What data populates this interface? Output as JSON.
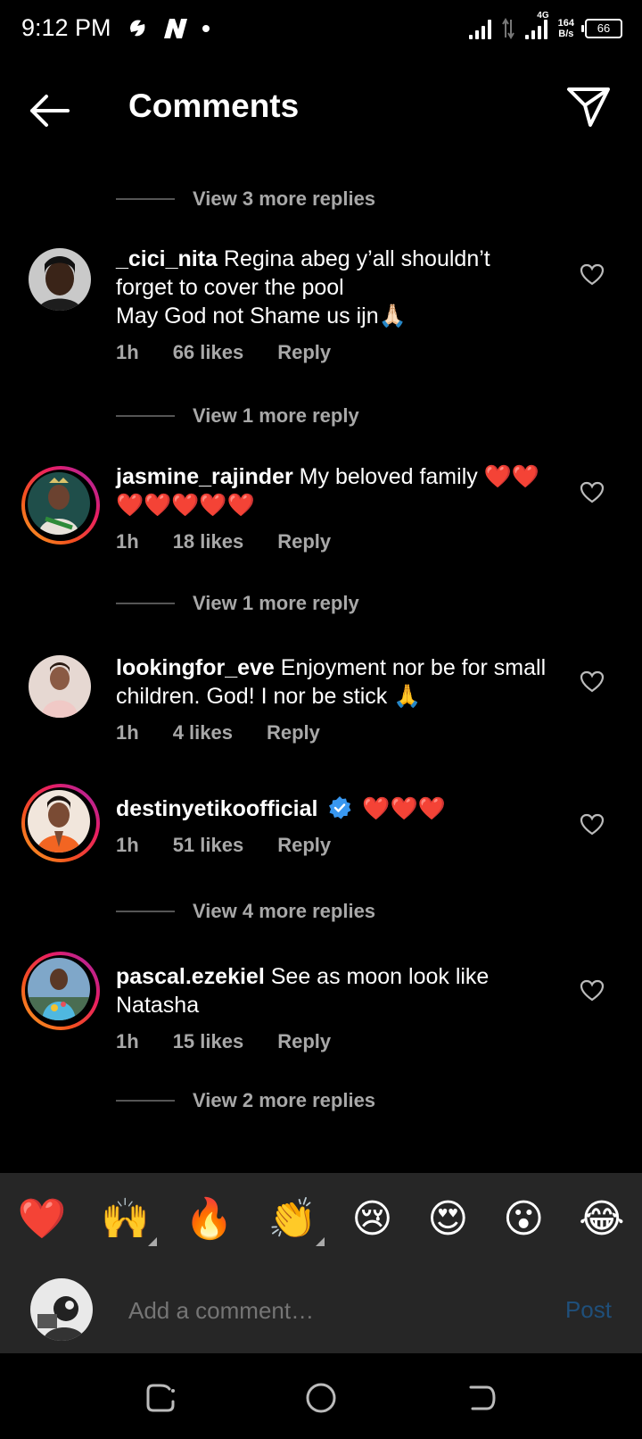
{
  "status_bar": {
    "time": "9:12 PM",
    "network_speed_value": "164",
    "network_speed_unit": "B/s",
    "network_type": "4G",
    "battery": "66"
  },
  "header": {
    "title": "Comments"
  },
  "view_more": [
    "View 3 more replies",
    "View 1 more reply",
    "View 1 more reply",
    "View 4 more replies",
    "View 2 more replies"
  ],
  "comments": [
    {
      "username": "_cici_nita",
      "text": "Regina abeg y’all shouldn’t forget to cover the pool",
      "text2": "May God not Shame us ijn🙏🏻",
      "time": "1h",
      "likes": "66 likes",
      "reply": "Reply"
    },
    {
      "username": "jasmine_rajinder",
      "text": "My beloved family ❤️❤️❤️❤️❤️❤️❤️",
      "time": "1h",
      "likes": "18 likes",
      "reply": "Reply"
    },
    {
      "username": "lookingfor_eve",
      "text": "Enjoyment nor be for small children. God! I nor be stick 🙏",
      "time": "1h",
      "likes": "4 likes",
      "reply": "Reply"
    },
    {
      "username": "destinyetikoofficial",
      "text": "❤️❤️❤️",
      "time": "1h",
      "likes": "51 likes",
      "reply": "Reply"
    },
    {
      "username": "pascal.ezekiel",
      "text": "See as moon look like Natasha",
      "time": "1h",
      "likes": "15 likes",
      "reply": "Reply"
    }
  ],
  "emoji_bar": [
    "❤️",
    "🙌",
    "🔥",
    "👏",
    "😢",
    "😍",
    "😮",
    "😂"
  ],
  "composer": {
    "placeholder": "Add a comment…",
    "post_label": "Post"
  },
  "colors": {
    "background": "#000000",
    "panel": "#262626",
    "meta_text": "#a8a8a8",
    "post_disabled": "#1f4f7a",
    "verified": "#3897f0"
  }
}
